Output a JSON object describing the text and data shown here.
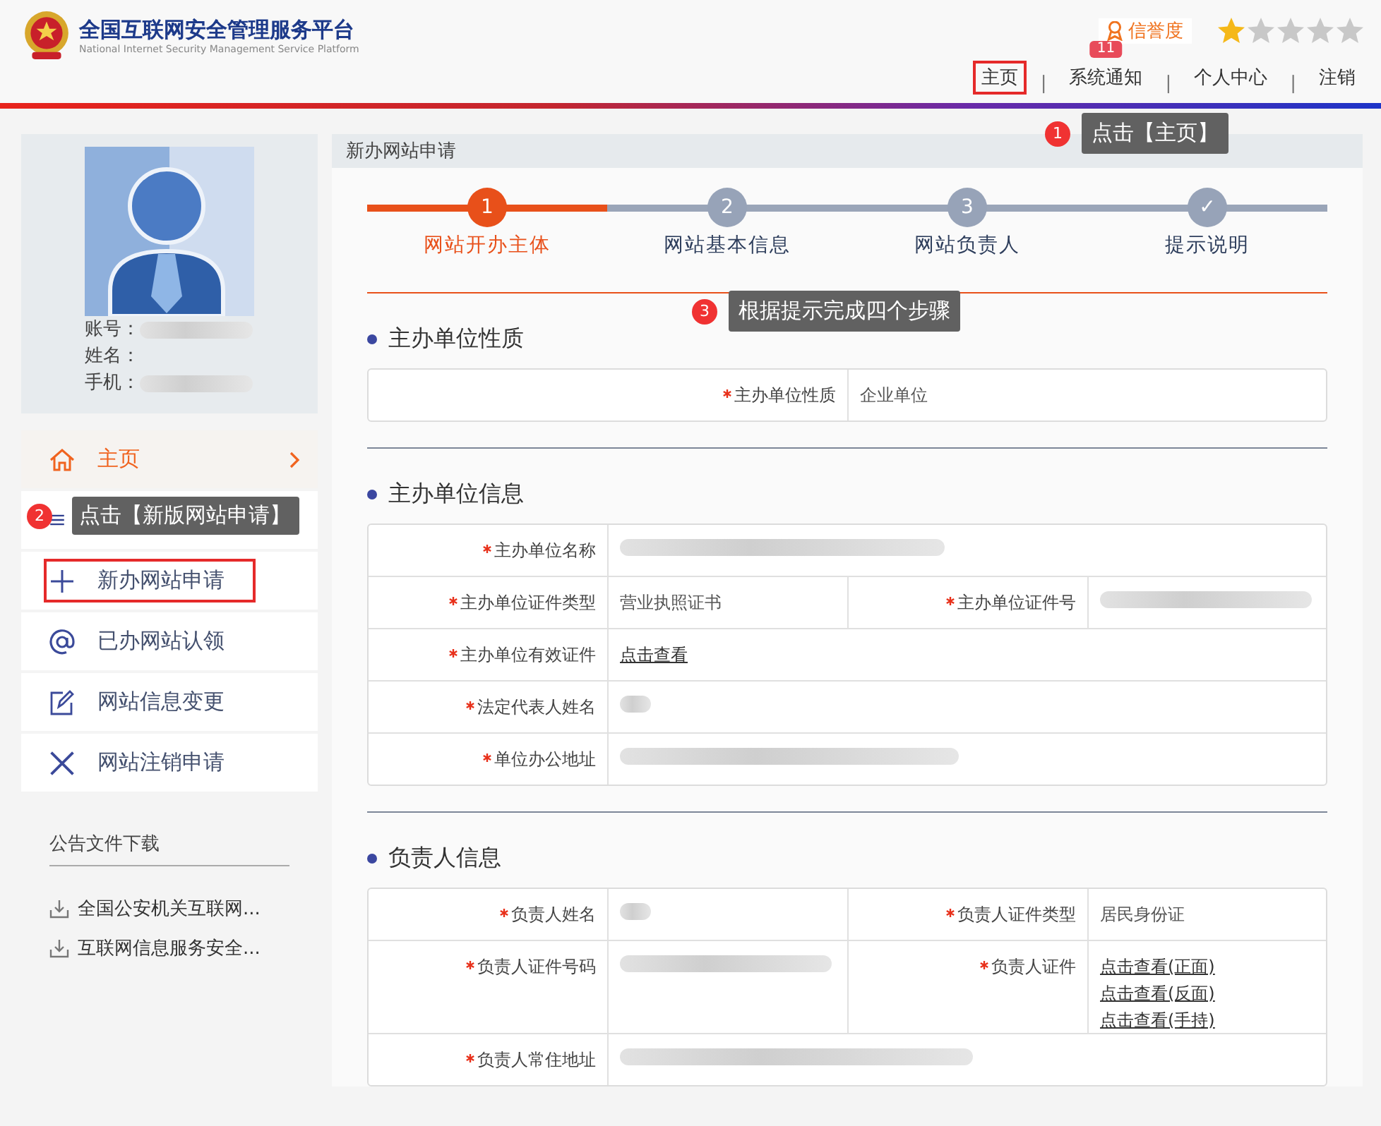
{
  "header": {
    "title": "全国互联网安全管理服务平台",
    "subtitle": "National Internet Security Management Service Platform",
    "credit_label": "信誉度",
    "stars": 1,
    "nav": [
      {
        "kind": "link",
        "text": "主页",
        "highlighted": true
      },
      {
        "kind": "separator",
        "text": "|"
      },
      {
        "kind": "link",
        "text": "系统通知",
        "badge": "11",
        "highlighted": false
      },
      {
        "kind": "separator",
        "text": "|"
      },
      {
        "kind": "link",
        "text": "个人中心",
        "highlighted": false
      },
      {
        "kind": "separator",
        "text": "|"
      },
      {
        "kind": "link",
        "text": "注销",
        "highlighted": false
      }
    ]
  },
  "profile": {
    "fields": [
      {
        "label": "账号：",
        "redacted": true
      },
      {
        "label": "姓名：",
        "redacted": false
      },
      {
        "label": "手机：",
        "redacted": true
      }
    ]
  },
  "sidebar": {
    "items": [
      {
        "kind": "home",
        "label": "主页",
        "selected": true,
        "highlighted": false
      },
      {
        "kind": "list",
        "highlighted": false,
        "selected": false
      },
      {
        "kind": "plus",
        "label": "新办网站申请",
        "selected": false,
        "highlighted": true
      },
      {
        "kind": "at",
        "label": "已办网站认领",
        "selected": false,
        "highlighted": false
      },
      {
        "kind": "edit",
        "label": "网站信息变更",
        "selected": false,
        "highlighted": false
      },
      {
        "kind": "close",
        "label": "网站注销申请",
        "selected": false,
        "highlighted": false
      }
    ],
    "downloads_title": "公告文件下载",
    "downloads": [
      "全国公安机关互联网...",
      "互联网信息服务安全..."
    ]
  },
  "panel": {
    "title": "新办网站申请",
    "steps": [
      {
        "marker": "1",
        "label": "网站开办主体",
        "selected": true
      },
      {
        "marker": "2",
        "label": "网站基本信息",
        "selected": false
      },
      {
        "marker": "3",
        "label": "网站负责人",
        "selected": false
      },
      {
        "marker": "✓",
        "label": "提示说明",
        "selected": false
      }
    ],
    "sections": [
      {
        "title": "主办单位性质",
        "rows": [
          {
            "kind": "half",
            "cells": [
              {
                "label": "主办单位性质",
                "required": true,
                "value": "企业单位"
              }
            ]
          }
        ]
      },
      {
        "title": "主办单位信息",
        "rows": [
          {
            "kind": "single",
            "cells": [
              {
                "label": "主办单位名称",
                "required": true,
                "redacted": true
              }
            ]
          },
          {
            "kind": "double",
            "cells": [
              {
                "label": "主办单位证件类型",
                "required": true,
                "value": "营业执照证书"
              },
              {
                "label": "主办单位证件号",
                "required": true,
                "redacted": true
              }
            ]
          },
          {
            "kind": "single",
            "cells": [
              {
                "label": "主办单位有效证件",
                "required": true,
                "links": [
                  "点击查看"
                ]
              }
            ]
          },
          {
            "kind": "single",
            "cells": [
              {
                "label": "法定代表人姓名",
                "required": true,
                "redacted": true
              }
            ]
          },
          {
            "kind": "single",
            "cells": [
              {
                "label": "单位办公地址",
                "required": true,
                "redacted": true
              }
            ]
          }
        ]
      },
      {
        "title": "负责人信息",
        "rows": [
          {
            "kind": "double",
            "cells": [
              {
                "label": "负责人姓名",
                "required": true,
                "redacted": true
              },
              {
                "label": "负责人证件类型",
                "required": true,
                "value": "居民身份证"
              }
            ]
          },
          {
            "kind": "double",
            "cells": [
              {
                "label": "负责人证件号码",
                "required": true,
                "redacted": true
              },
              {
                "label": "负责人证件",
                "required": true,
                "links": [
                  "点击查看(正面)",
                  "点击查看(反面)",
                  "点击查看(手持)"
                ]
              }
            ]
          },
          {
            "kind": "single",
            "cells": [
              {
                "label": "负责人常住地址",
                "required": true,
                "redacted": true
              }
            ]
          }
        ]
      }
    ]
  },
  "annotations": [
    {
      "number": "1",
      "text": "点击【主页】"
    },
    {
      "number": "2",
      "text": "点击【新版网站申请】"
    },
    {
      "number": "3",
      "text": "根据提示完成四个步骤"
    }
  ]
}
